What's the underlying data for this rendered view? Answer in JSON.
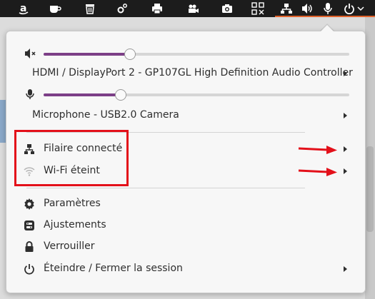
{
  "panel": {
    "icons": [
      "amazon-app-icon",
      "coffee-icon",
      "trash-icon",
      "settings-gear-icon",
      "printer-icon",
      "video-camera-icon",
      "camera-icon",
      "qr-grid-icon",
      "wired-network-icon",
      "volume-icon",
      "microphone-icon",
      "power-icon"
    ],
    "accent": "#e0622b"
  },
  "menu": {
    "output": {
      "device_label": "HDMI / DisplayPort 2 - GP107GL High Definition Audio Controller",
      "volume_level": 0.28
    },
    "input": {
      "device_label": "Microphone - USB2.0 Camera",
      "volume_level": 0.25
    },
    "network": {
      "wired_label": "Filaire connecté",
      "wifi_label": "Wi-Fi éteint"
    },
    "items": {
      "settings_label": "Paramètres",
      "tweaks_label": "Ajustements",
      "lock_label": "Verrouiller",
      "power_label": "Éteindre / Fermer la session"
    }
  },
  "annotation": {
    "highlight_color": "#e3101a"
  }
}
